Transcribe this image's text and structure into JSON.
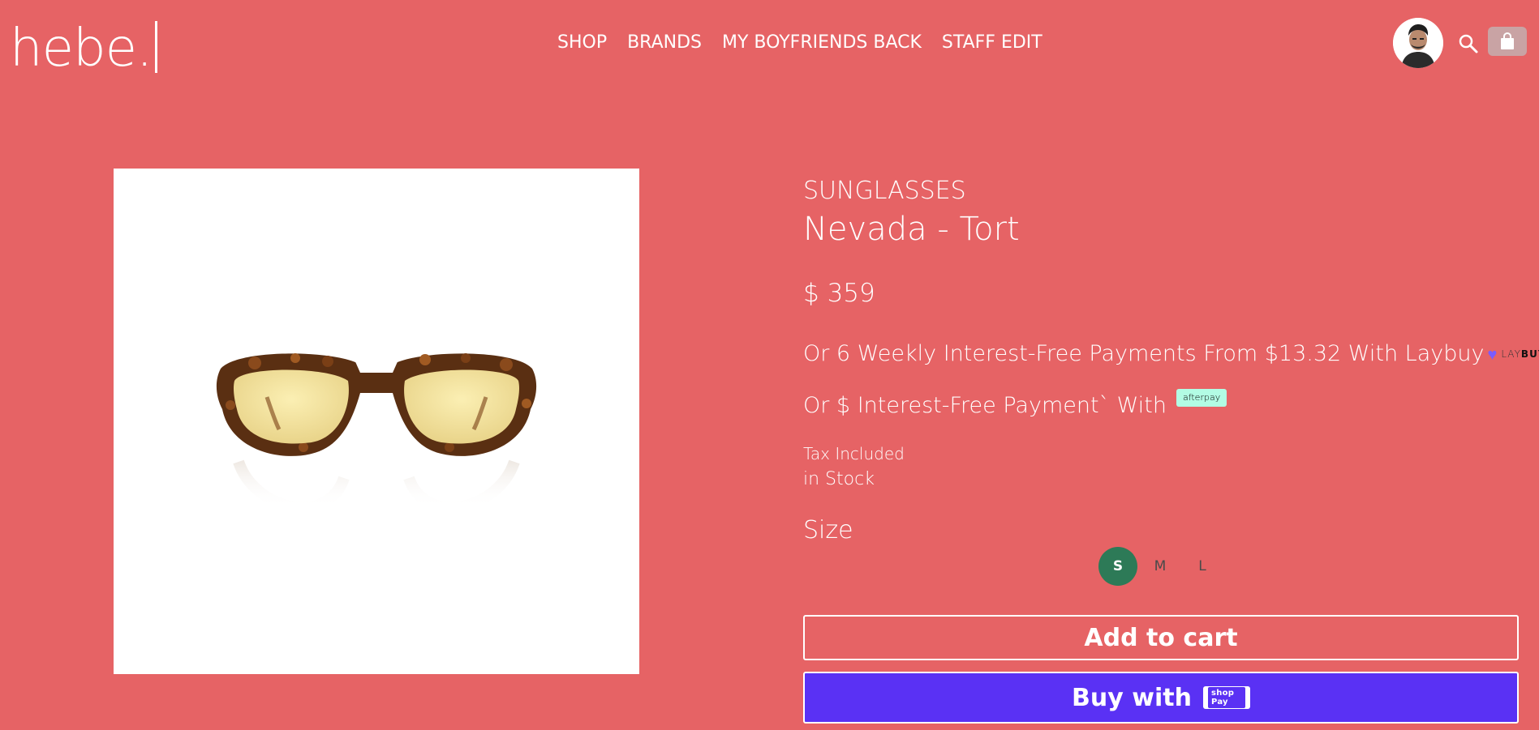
{
  "header": {
    "logo": "hebe.",
    "nav": [
      "SHOP",
      "BRANDS",
      "MY BOYFRIENDS BACK",
      "STAFF EDIT"
    ]
  },
  "product": {
    "category": "SUNGLASSES",
    "title": "Nevada - Tort",
    "price": "$ 359",
    "laybuy_text": "Or 6 Weekly Interest-Free Payments From $13.32 With Laybuy",
    "laybuy_logo": {
      "lay": "LAY",
      "buy": "BUY"
    },
    "afterpay_text": "Or $ Interest-Free Payment` With",
    "afterpay_badge": "afterpay",
    "tax_text": "Tax Included",
    "stock_text": "in Stock",
    "size_label": "Size",
    "sizes": [
      "S",
      "M",
      "L"
    ],
    "selected_size": "S",
    "add_to_cart_label": "Add to cart",
    "buy_with_label": "Buy with",
    "shoppay_badge": "shop Pay"
  },
  "colors": {
    "background": "#e66365",
    "selected_size": "#2d7a57",
    "shop_pay": "#5a31f4",
    "afterpay": "#b2fce4"
  },
  "icons": {
    "search": "search-icon",
    "bag": "shopping-bag-icon"
  }
}
